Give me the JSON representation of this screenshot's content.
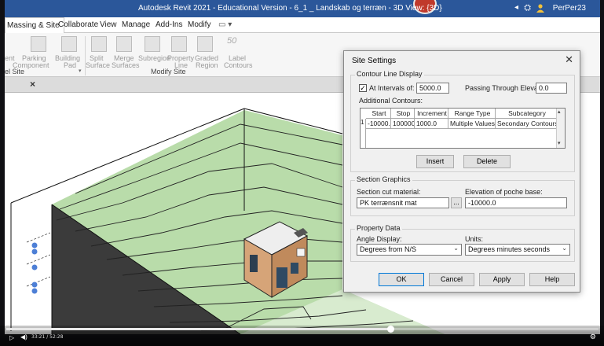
{
  "window": {
    "title": "Autodesk Revit 2021 - Educational Version - 6_1 _ Landskab og terræn - 3D View: {3D}",
    "user": "PerPer23"
  },
  "tabs": [
    {
      "label": "Massing & Site",
      "active": true
    },
    {
      "label": "Collaborate"
    },
    {
      "label": "View"
    },
    {
      "label": "Manage"
    },
    {
      "label": "Add-Ins"
    },
    {
      "label": "Modify"
    }
  ],
  "ribbon": {
    "tools": [
      {
        "line1": "",
        "line2": "ent"
      },
      {
        "line1": "Parking",
        "line2": "Component"
      },
      {
        "line1": "Building",
        "line2": "Pad"
      },
      {
        "line1": "Split",
        "line2": "Surface"
      },
      {
        "line1": "Merge",
        "line2": "Surfaces"
      },
      {
        "line1": "Subregion",
        "line2": ""
      },
      {
        "line1": "Property",
        "line2": "Line"
      },
      {
        "line1": "Graded",
        "line2": "Region"
      },
      {
        "line1": "Label",
        "line2": "Contours"
      }
    ],
    "panels": {
      "site": "el Site",
      "modify_site": "Modify Site"
    },
    "label_icon_text": "50"
  },
  "viewtab": {
    "close": "×"
  },
  "dialog": {
    "title": "Site Settings",
    "close": "✕",
    "contour": {
      "group": "Contour Line Display",
      "at_intervals_label": "At Intervals of:",
      "at_intervals_checked": true,
      "interval_value": "5000.0",
      "passing_label": "Passing Through Elevation:",
      "passing_value": "0.0",
      "additional_label": "Additional Contours:",
      "columns": [
        "Start",
        "Stop",
        "Increment",
        "Range Type",
        "Subcategory"
      ],
      "rows": [
        {
          "num": "1",
          "start": "-10000.",
          "stop": "100000",
          "increment": "1000.0",
          "range_type": "Multiple Values",
          "subcategory": "Secondary Contours"
        }
      ],
      "insert": "Insert",
      "delete": "Delete"
    },
    "section": {
      "group": "Section Graphics",
      "cut_label": "Section cut material:",
      "cut_value": "PK terrænsnit mat",
      "browse": "...",
      "poche_label": "Elevation of poche base:",
      "poche_value": "-10000.0"
    },
    "property": {
      "group": "Property Data",
      "angle_label": "Angle Display:",
      "angle_value": "Degrees from N/S",
      "units_label": "Units:",
      "units_value": "Degrees minutes seconds"
    },
    "buttons": {
      "ok": "OK",
      "cancel": "Cancel",
      "apply": "Apply",
      "help": "Help"
    }
  },
  "player": {
    "timecode": "33:21 / 52:28",
    "progress": 0.648
  }
}
